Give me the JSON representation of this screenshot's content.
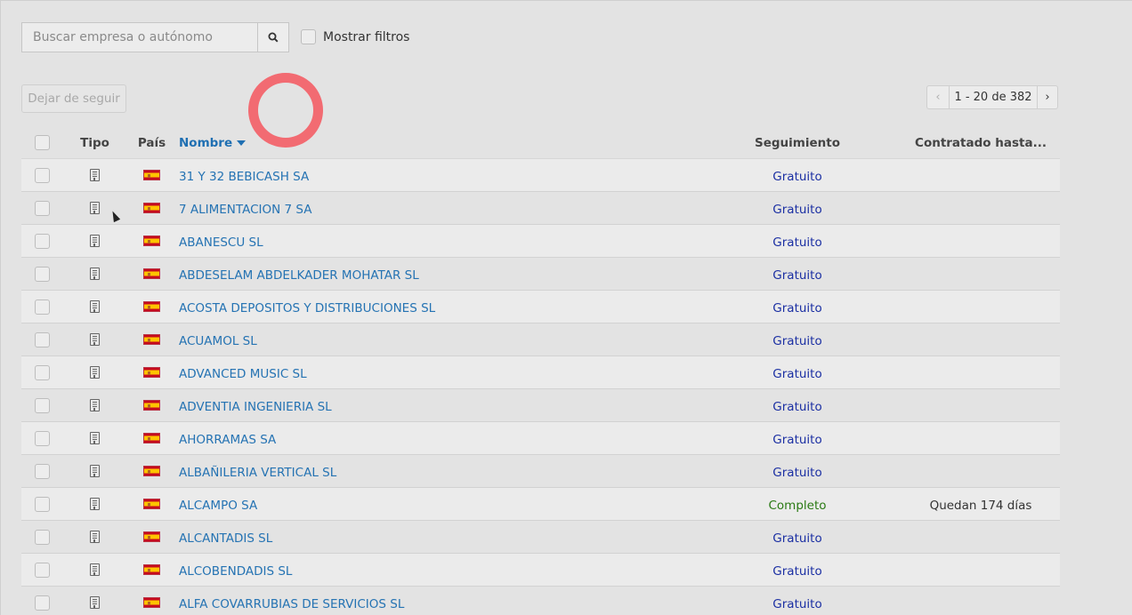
{
  "search": {
    "placeholder": "Buscar empresa o autónomo",
    "value": ""
  },
  "filters": {
    "label": "Mostrar filtros"
  },
  "actions": {
    "unfollow_label": "Dejar de seguir"
  },
  "pager": {
    "prev": "‹",
    "range": "1 - 20 de 382",
    "next": "›"
  },
  "table": {
    "headers": {
      "type": "Tipo",
      "country": "País",
      "name": "Nombre",
      "follow": "Seguimiento",
      "until": "Contratado hasta..."
    },
    "rows": [
      {
        "name": "31 Y 32 BEBICASH SA",
        "follow": "Gratuito",
        "until": ""
      },
      {
        "name": "7 ALIMENTACION 7 SA",
        "follow": "Gratuito",
        "until": ""
      },
      {
        "name": "ABANESCU SL",
        "follow": "Gratuito",
        "until": ""
      },
      {
        "name": "ABDESELAM ABDELKADER MOHATAR SL",
        "follow": "Gratuito",
        "until": ""
      },
      {
        "name": "ACOSTA DEPOSITOS Y DISTRIBUCIONES SL",
        "follow": "Gratuito",
        "until": ""
      },
      {
        "name": "ACUAMOL SL",
        "follow": "Gratuito",
        "until": ""
      },
      {
        "name": "ADVANCED MUSIC SL",
        "follow": "Gratuito",
        "until": ""
      },
      {
        "name": "ADVENTIA INGENIERIA SL",
        "follow": "Gratuito",
        "until": ""
      },
      {
        "name": "AHORRAMAS SA",
        "follow": "Gratuito",
        "until": ""
      },
      {
        "name": "ALBAÑILERIA VERTICAL SL",
        "follow": "Gratuito",
        "until": ""
      },
      {
        "name": "ALCAMPO SA",
        "follow": "Completo",
        "until": "Quedan 174 días"
      },
      {
        "name": "ALCANTADIS SL",
        "follow": "Gratuito",
        "until": ""
      },
      {
        "name": "ALCOBENDADIS SL",
        "follow": "Gratuito",
        "until": ""
      },
      {
        "name": "ALFA COVARRUBIAS DE SERVICIOS SL",
        "follow": "Gratuito",
        "until": ""
      }
    ]
  },
  "colors": {
    "link": "#2573b3",
    "free": "#1b2fa3",
    "full": "#2a7a14",
    "click_marker": "#f26b72"
  }
}
